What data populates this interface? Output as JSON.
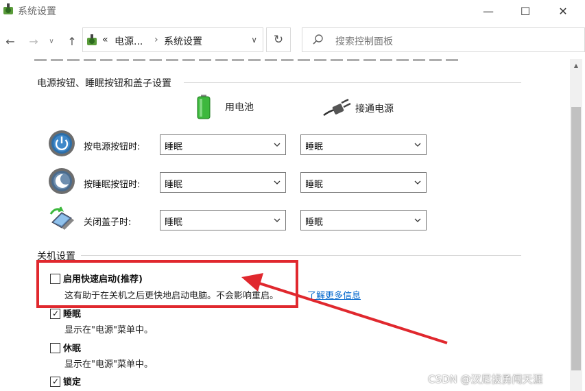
{
  "window": {
    "title": "系统设置",
    "minimize": "—",
    "maximize": "☐",
    "close": "✕"
  },
  "nav": {
    "back": "←",
    "forward": "→",
    "recent": "∨",
    "up": "↑",
    "address_prefix": "«",
    "address_crumb1": "电源...",
    "address_sep": "›",
    "address_crumb2": "系统设置",
    "address_dropdown": "∨",
    "refresh": "↻",
    "search_placeholder": "搜索控制面板"
  },
  "power_section": {
    "title": "电源按钮、睡眠按钮和盖子设置",
    "col_battery": "用电池",
    "col_plugged": "接通电源",
    "rows": [
      {
        "label": "按电源按钮时:",
        "battery": "睡眠",
        "plugged": "睡眠",
        "icon": "power-button-icon"
      },
      {
        "label": "按睡眠按钮时:",
        "battery": "睡眠",
        "plugged": "睡眠",
        "icon": "sleep-button-icon"
      },
      {
        "label": "关闭盖子时:",
        "battery": "睡眠",
        "plugged": "睡眠",
        "icon": "laptop-lid-icon"
      }
    ]
  },
  "shutdown_section": {
    "title": "关机设置",
    "items": [
      {
        "label": "启用快速启动(推荐)",
        "checked": false,
        "desc": "这有助于在关机之后更快地启动电脑。不会影响重启。",
        "link": "了解更多信息"
      },
      {
        "label": "睡眠",
        "checked": true,
        "desc": "显示在\"电源\"菜单中。"
      },
      {
        "label": "休眠",
        "checked": false,
        "desc": "显示在\"电源\"菜单中。"
      },
      {
        "label": "锁定",
        "checked": true
      }
    ]
  },
  "scrollbar": {
    "up": "▲"
  },
  "watermark": "CSDN @汉尼拔勇闯天涯",
  "colors": {
    "highlight": "#e0282e",
    "link": "#0066cc",
    "battery": "#3db83d"
  }
}
